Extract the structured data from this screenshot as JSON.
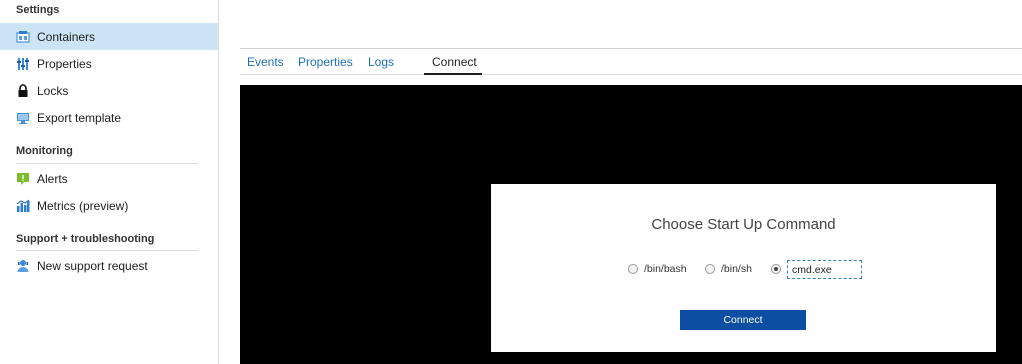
{
  "sidebar": {
    "settings_header": "Settings",
    "settings_items": [
      {
        "label": "Containers",
        "icon": "containers-icon",
        "active": true
      },
      {
        "label": "Properties",
        "icon": "properties-icon"
      },
      {
        "label": "Locks",
        "icon": "lock-icon"
      },
      {
        "label": "Export template",
        "icon": "export-template-icon"
      }
    ],
    "monitoring_header": "Monitoring",
    "monitoring_items": [
      {
        "label": "Alerts",
        "icon": "alert-icon"
      },
      {
        "label": "Metrics (preview)",
        "icon": "metrics-icon"
      }
    ],
    "support_header": "Support + troubleshooting",
    "support_items": [
      {
        "label": "New support request",
        "icon": "support-person-icon"
      }
    ]
  },
  "tabs": [
    {
      "label": "Events"
    },
    {
      "label": "Properties"
    },
    {
      "label": "Logs"
    },
    {
      "label": "Connect",
      "active": true
    }
  ],
  "dialog": {
    "title": "Choose Start Up Command",
    "options": [
      {
        "label": "/bin/bash",
        "selected": false
      },
      {
        "label": "/bin/sh",
        "selected": false
      },
      {
        "label": "",
        "selected": true
      }
    ],
    "custom_command_value": "cmd.exe",
    "connect_label": "Connect"
  },
  "colors": {
    "active_nav_bg": "#cce4f6",
    "tab_link": "#1f6fb8",
    "terminal_bg": "#000000",
    "button_bg": "#0b4ea2"
  }
}
